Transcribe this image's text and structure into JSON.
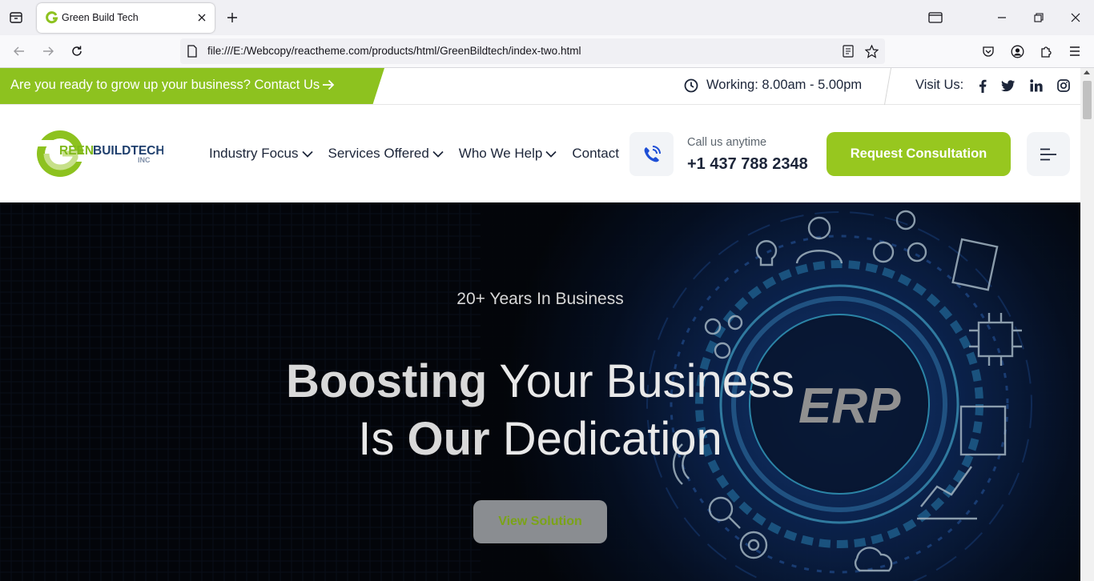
{
  "browser": {
    "tab_title": "Green Build Tech",
    "url": "file:///E:/Webcopy/reactheme.com/products/html/GreenBildtech/index-two.html"
  },
  "topbar": {
    "promo": "Are you ready to grow up your business? Contact Us",
    "hours": "Working: 8.00am - 5.00pm",
    "visit_label": "Visit Us:",
    "social_icons": [
      "facebook-icon",
      "twitter-icon",
      "linkedin-icon",
      "instagram-icon"
    ]
  },
  "header": {
    "logo_text": "REENBUILDTECH",
    "logo_sub": "INC",
    "menu": [
      {
        "label": "Industry Focus"
      },
      {
        "label": "Services Offered"
      },
      {
        "label": "Who We Help"
      },
      {
        "label": "Contact"
      }
    ],
    "call_label": "Call us anytime",
    "call_number": "+1 437 788 2348",
    "cta": "Request Consultation"
  },
  "hero": {
    "subtitle": "20+ Years In Business",
    "title_bold_1": "Boosting",
    "title_thin_1": " Your Business",
    "title_thin_2": "Is ",
    "title_bold_2": "Our",
    "title_thin_3": " Dedication",
    "button": "View Solution",
    "erp_label": "ERP"
  },
  "colors": {
    "brand_green": "#8dc21f",
    "cta_green": "#97c71f",
    "navy": "#1c2539",
    "phone_blue": "#1e4fd6"
  }
}
